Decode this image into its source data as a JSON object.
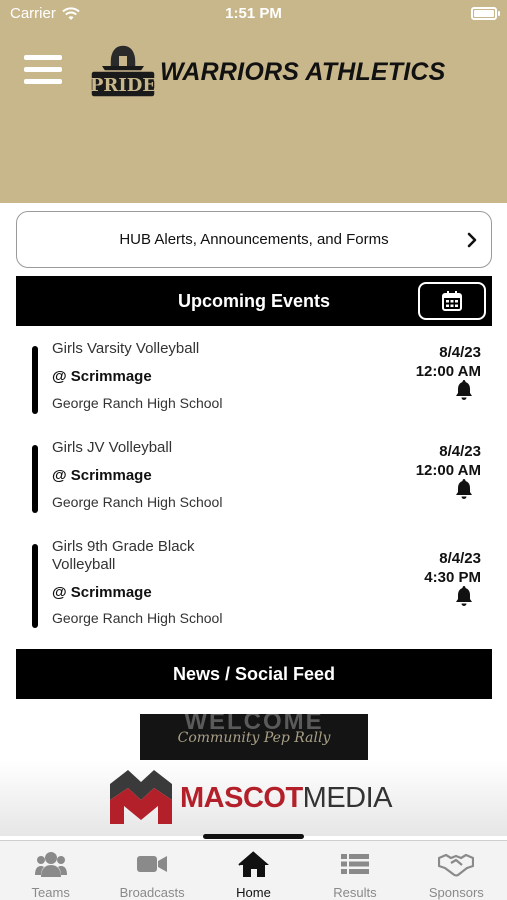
{
  "status_bar": {
    "carrier": "Carrier",
    "time": "1:51 PM",
    "wifi_icon": "wifi-icon",
    "battery_icon": "battery-icon"
  },
  "header": {
    "background": "#c9b78c",
    "menu_icon": "hamburger-menu-icon",
    "logo_text": "PRIDE",
    "title": "WARRIORS ATHLETICS"
  },
  "hub": {
    "label": "HUB Alerts, Announcements, and Forms",
    "icon": "chevron-right-icon"
  },
  "upcoming": {
    "title": "Upcoming Events",
    "calendar_icon": "calendar-icon",
    "events": [
      {
        "team": "Girls Varsity Volleyball",
        "opponent": "@ Scrimmage",
        "venue": "George Ranch High School",
        "date": "8/4/23",
        "time": "12:00 AM"
      },
      {
        "team": "Girls JV Volleyball",
        "opponent": "@ Scrimmage",
        "venue": "George Ranch High School",
        "date": "8/4/23",
        "time": "12:00 AM"
      },
      {
        "team": "Girls 9th Grade Black Volleyball",
        "opponent": "@ Scrimmage",
        "venue": "George Ranch High School",
        "date": "8/4/23",
        "time": "4:30 PM"
      }
    ]
  },
  "news": {
    "title": "News / Social Feed",
    "image_text_1": "WELCOME",
    "image_text_2": "Community Pep Rally"
  },
  "sponsor": {
    "brand_a": "MASCOT",
    "brand_b": "MEDIA",
    "accent": "#b3202a"
  },
  "tabs": [
    {
      "label": "Teams",
      "icon": "teams-icon"
    },
    {
      "label": "Broadcasts",
      "icon": "video-camera-icon"
    },
    {
      "label": "Home",
      "icon": "home-icon",
      "active": true
    },
    {
      "label": "Results",
      "icon": "list-icon"
    },
    {
      "label": "Sponsors",
      "icon": "handshake-icon"
    }
  ]
}
